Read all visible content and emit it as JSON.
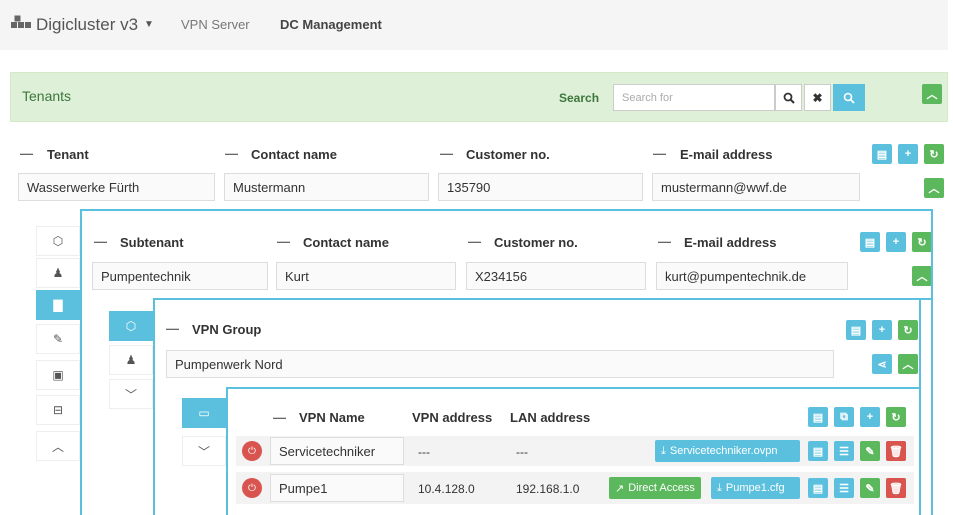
{
  "nav": {
    "brand": "Digicluster v3",
    "links": [
      "VPN Server",
      "DC Management"
    ]
  },
  "tenants_panel": {
    "title": "Tenants",
    "search_label": "Search",
    "search_placeholder": "Search for"
  },
  "tenant": {
    "headers": [
      "Tenant",
      "Contact name",
      "Customer no.",
      "E-mail address"
    ],
    "values": [
      "Wasserwerke Fürth",
      "Mustermann",
      "135790",
      "mustermann@wwf.de"
    ]
  },
  "subtenant": {
    "headers": [
      "Subtenant",
      "Contact name",
      "Customer no.",
      "E-mail address"
    ],
    "values": [
      "Pumpentechnik",
      "Kurt",
      "X234156",
      "kurt@pumpentechnik.de"
    ]
  },
  "vpn_group": {
    "header": "VPN Group",
    "value": "Pumpenwerk Nord"
  },
  "vpn_table": {
    "headers": [
      "VPN Name",
      "VPN address",
      "LAN address"
    ],
    "rows": [
      {
        "name": "Servicetechniker",
        "vpn": "---",
        "lan": "---",
        "download": "Servicetechniker.ovpn",
        "direct": ""
      },
      {
        "name": "Pumpe1",
        "vpn": "10.4.128.0",
        "lan": "192.168.1.0",
        "download": "Pumpe1.cfg",
        "direct": "Direct Access"
      }
    ]
  },
  "colors": {
    "success_bg": "#dff0d8",
    "info": "#5bc0de",
    "success": "#5cb85c",
    "danger": "#d9534f"
  }
}
